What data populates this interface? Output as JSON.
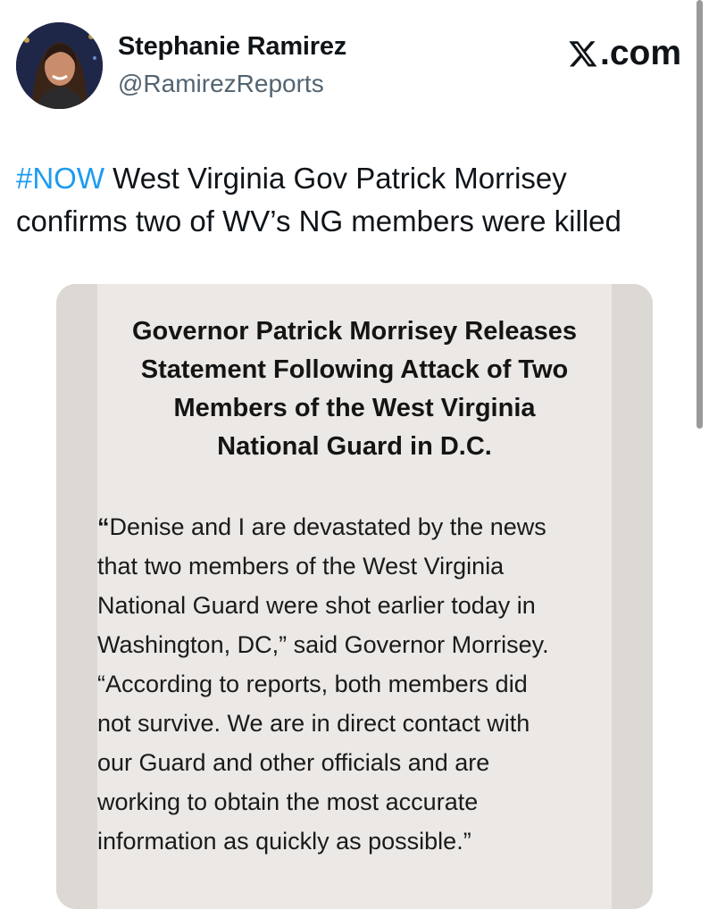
{
  "author": {
    "name": "Stephanie Ramirez",
    "handle": "@RamirezReports"
  },
  "brand": {
    "label": ".com",
    "icon": "x-logo-icon"
  },
  "tweet": {
    "hashtag": "#NOW",
    "line1_rest": " West Virginia Gov Patrick Morrisey",
    "line2": "confirms two of WV’s NG members were killed"
  },
  "statement": {
    "title_lines": [
      "Governor Patrick Morrisey Releases",
      "Statement Following Attack of Two",
      "Members of the West Virginia",
      "National Guard in D.C."
    ],
    "body_open_quote": "“",
    "body_lines": [
      "Denise and I are devastated by the news",
      "that two members of the West Virginia",
      "National Guard were shot earlier today in",
      "Washington, DC,” said Governor Morrisey.",
      "“According to reports, both members did",
      "not survive. We are in direct contact with",
      "our Guard and other officials and are",
      "working to obtain the most accurate",
      "information as quickly as possible.”"
    ]
  },
  "colors": {
    "hashtag": "#1d9bf0",
    "handle": "#536471",
    "media_bg": "#e6e3e0"
  }
}
